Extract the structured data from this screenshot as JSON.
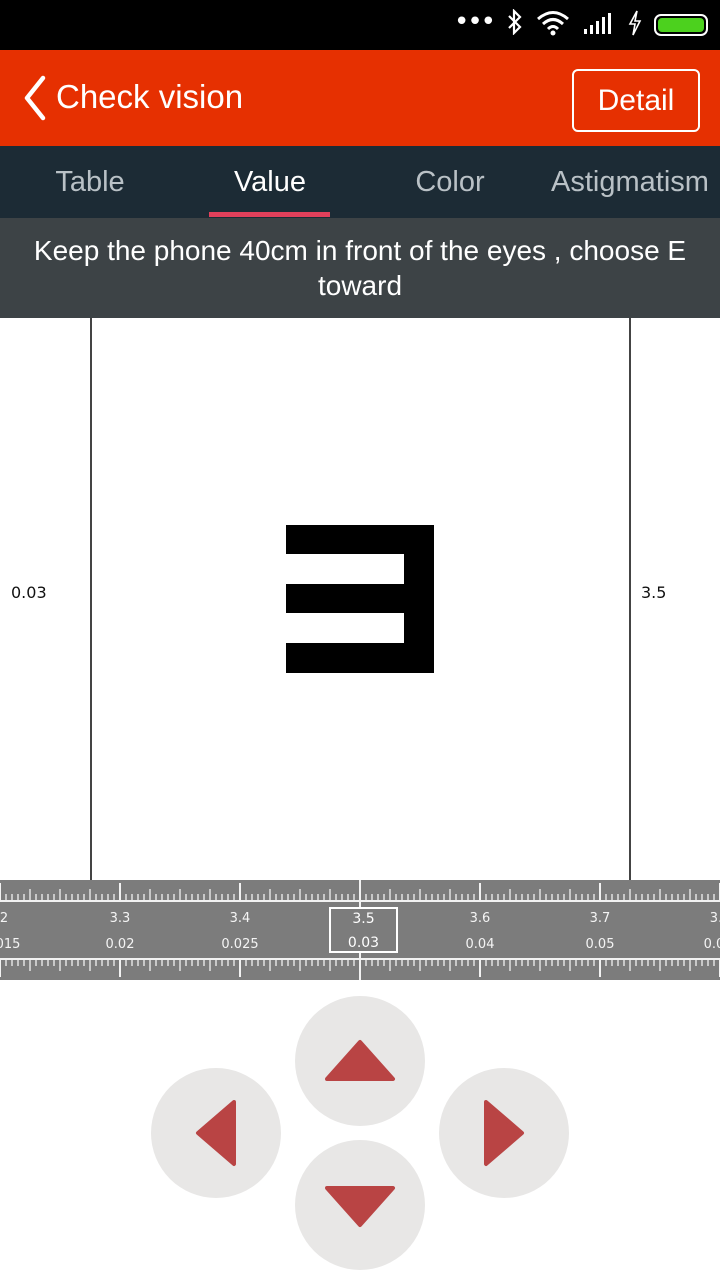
{
  "app": {
    "title": "Check vision",
    "detail_label": "Detail"
  },
  "tabs": [
    {
      "label": "Table",
      "active": false
    },
    {
      "label": "Value",
      "active": true
    },
    {
      "label": "Color",
      "active": false
    },
    {
      "label": "Astigmatism",
      "active": false
    }
  ],
  "instruction": "Keep the phone 40cm in front of the eyes , choose E toward",
  "test": {
    "left_value": "0.03",
    "right_value": "3.5",
    "optotype_direction": "left"
  },
  "ruler": {
    "values": [
      "2",
      "3.3",
      "3.4",
      "3.5",
      "3.6",
      "3.7",
      "3."
    ],
    "decimals": [
      "015",
      "0.02",
      "0.025",
      "0.03",
      "0.04",
      "0.05",
      "0.0"
    ],
    "selected_value": "3.5",
    "selected_decimal": "0.03"
  },
  "colors": {
    "header": "#e63001",
    "tab_bar": "#1c2b35",
    "tab_indicator": "#e2405b",
    "instruction_bg": "#3d4346",
    "ruler_bg": "#7c7c7c",
    "arrow": "#b94444",
    "dpad_bg": "#e8e7e6",
    "battery": "#4cd11e"
  },
  "controls": {
    "up": "arrow-up-icon",
    "down": "arrow-down-icon",
    "left": "arrow-left-icon",
    "right": "arrow-right-icon"
  }
}
